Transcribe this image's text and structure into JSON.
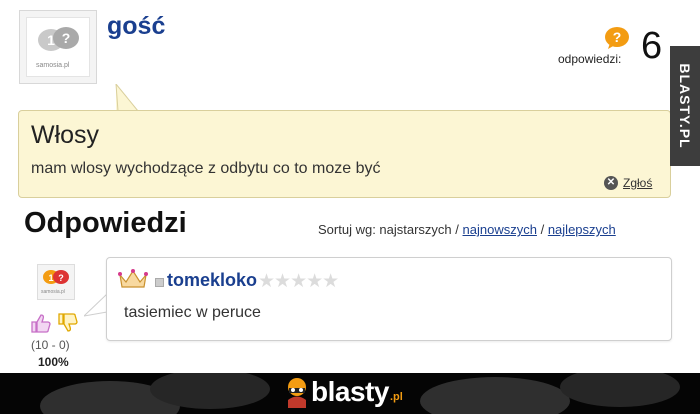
{
  "question": {
    "author": "gość",
    "avatar_logo": "samosia.pl",
    "answers_label": "odpowiedzi:",
    "answers_count": "6",
    "title": "Włosy",
    "body": "mam wlosy wychodzące z odbytu co to moze być",
    "report_label": "Zgłoś"
  },
  "answers_section": {
    "heading": "Odpowiedzi",
    "sort_prefix": "Sortuj wg: najstarszych /",
    "sort_newest": "najnowszych",
    "sort_separator": "/",
    "sort_best": "najlepszych"
  },
  "answer": {
    "avatar_logo": "samosia.pl",
    "username": "tomekloko",
    "rating_stars": 0,
    "stars_text": "★★★★★",
    "text": "tasiemiec w peruce",
    "votes": "(10 - 0)",
    "percent": "100%"
  },
  "watermark": {
    "text": "BLASTY.PL"
  },
  "footer": {
    "logo_text": "blasty",
    "logo_suffix": ".pl"
  },
  "colors": {
    "link_blue": "#1a3f8f",
    "question_bg": "#fcf6d4",
    "accent_orange": "#f39c12",
    "thumb_up": "#c76fc7",
    "thumb_down": "#e0a800"
  }
}
